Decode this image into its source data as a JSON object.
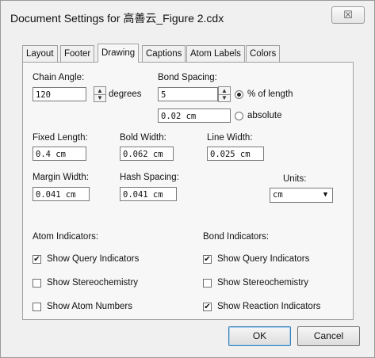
{
  "window": {
    "title": "Document Settings for 高善云_Figure 2.cdx",
    "close_glyph": "☒"
  },
  "tabs": [
    "Layout",
    "Footer",
    "Drawing",
    "Captions",
    "Atom Labels",
    "Colors"
  ],
  "active_tab": "Drawing",
  "chain_angle": {
    "label": "Chain Angle:",
    "value": "120",
    "unit": "degrees"
  },
  "bond_spacing": {
    "label": "Bond Spacing:",
    "value": "5",
    "absolute_value": "0.02 cm",
    "options": [
      "% of length",
      "absolute"
    ],
    "selected": "% of length"
  },
  "fixed_length": {
    "label": "Fixed Length:",
    "value": "0.4 cm"
  },
  "bold_width": {
    "label": "Bold Width:",
    "value": "0.062 cm"
  },
  "line_width": {
    "label": "Line Width:",
    "value": "0.025 cm"
  },
  "margin_width": {
    "label": "Margin Width:",
    "value": "0.041 cm"
  },
  "hash_spacing": {
    "label": "Hash Spacing:",
    "value": "0.041 cm"
  },
  "units": {
    "label": "Units:",
    "value": "cm"
  },
  "atom_indicators": {
    "label": "Atom Indicators:",
    "items": [
      {
        "label": "Show Query Indicators",
        "checked": true
      },
      {
        "label": "Show Stereochemistry",
        "checked": false
      },
      {
        "label": "Show Atom Numbers",
        "checked": false
      }
    ]
  },
  "bond_indicators": {
    "label": "Bond Indicators:",
    "items": [
      {
        "label": "Show Query Indicators",
        "checked": true
      },
      {
        "label": "Show Stereochemistry",
        "checked": false
      },
      {
        "label": "Show Reaction Indicators",
        "checked": true
      }
    ]
  },
  "buttons": {
    "ok": "OK",
    "cancel": "Cancel"
  },
  "glyphs": {
    "check": "✔",
    "spin_up": "▲",
    "spin_down": "▼",
    "dropdown": "▼"
  }
}
